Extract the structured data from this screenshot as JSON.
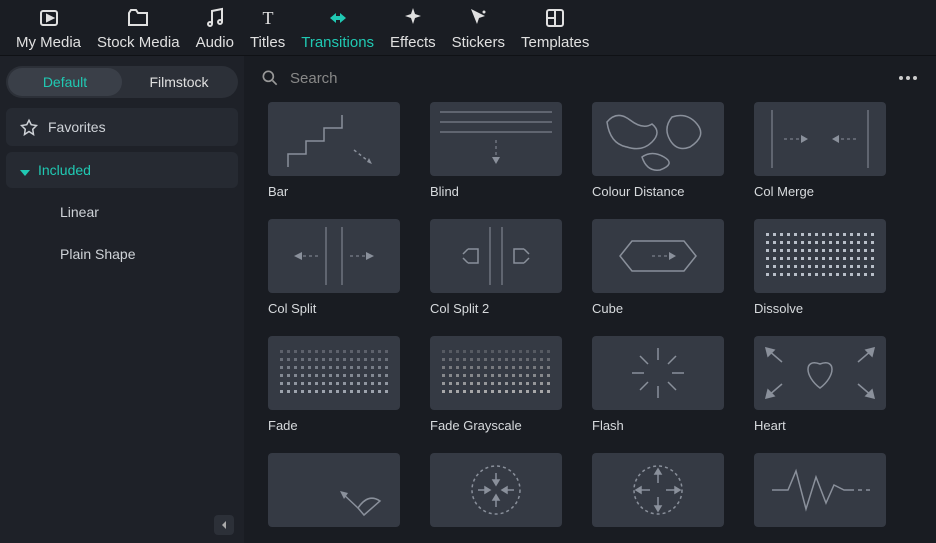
{
  "top_tabs": [
    {
      "id": "my-media",
      "label": "My Media"
    },
    {
      "id": "stock-media",
      "label": "Stock Media"
    },
    {
      "id": "audio",
      "label": "Audio"
    },
    {
      "id": "titles",
      "label": "Titles"
    },
    {
      "id": "transitions",
      "label": "Transitions"
    },
    {
      "id": "effects",
      "label": "Effects"
    },
    {
      "id": "stickers",
      "label": "Stickers"
    },
    {
      "id": "templates",
      "label": "Templates"
    }
  ],
  "active_tab": "transitions",
  "sidebar": {
    "pills": [
      {
        "id": "default",
        "label": "Default"
      },
      {
        "id": "filmstock",
        "label": "Filmstock"
      }
    ],
    "active_pill": "default",
    "items": [
      {
        "id": "favorites",
        "label": "Favorites",
        "icon": "star",
        "level": 0
      },
      {
        "id": "included",
        "label": "Included",
        "icon": "caret",
        "level": 0,
        "selected": true
      },
      {
        "id": "linear",
        "label": "Linear",
        "level": 1
      },
      {
        "id": "plain-shape",
        "label": "Plain Shape",
        "level": 1
      }
    ]
  },
  "search": {
    "placeholder": "Search",
    "value": ""
  },
  "transitions": [
    {
      "id": "bar",
      "label": "Bar",
      "thumb": "bar"
    },
    {
      "id": "blind",
      "label": "Blind",
      "thumb": "blind"
    },
    {
      "id": "colour-distance",
      "label": "Colour Distance",
      "thumb": "blobs"
    },
    {
      "id": "col-merge",
      "label": "Col Merge",
      "thumb": "colmerge"
    },
    {
      "id": "col-split",
      "label": "Col Split",
      "thumb": "colsplit"
    },
    {
      "id": "col-split-2",
      "label": "Col Split 2",
      "thumb": "colsplit2"
    },
    {
      "id": "cube",
      "label": "Cube",
      "thumb": "cube"
    },
    {
      "id": "dissolve",
      "label": "Dissolve",
      "thumb": "dots"
    },
    {
      "id": "fade",
      "label": "Fade",
      "thumb": "dots2"
    },
    {
      "id": "fade-grayscale",
      "label": "Fade Grayscale",
      "thumb": "dots3"
    },
    {
      "id": "flash",
      "label": "Flash",
      "thumb": "flash"
    },
    {
      "id": "heart",
      "label": "Heart",
      "thumb": "heart"
    },
    {
      "id": "t13",
      "label": "",
      "thumb": "kite"
    },
    {
      "id": "t14",
      "label": "",
      "thumb": "irisin"
    },
    {
      "id": "t15",
      "label": "",
      "thumb": "irisout"
    },
    {
      "id": "t16",
      "label": "",
      "thumb": "wave"
    }
  ]
}
